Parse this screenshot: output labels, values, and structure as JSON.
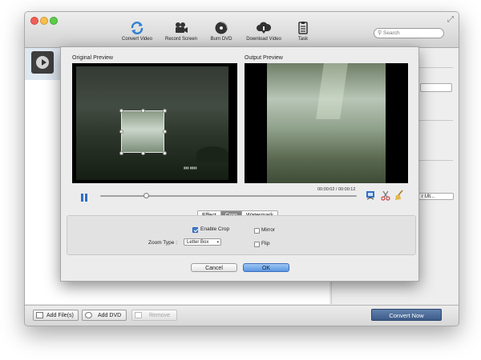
{
  "toolbar": {
    "items": [
      {
        "label": "Convert Video",
        "icon": "refresh-icon"
      },
      {
        "label": "Record Screen",
        "icon": "video-camera-icon"
      },
      {
        "label": "Burn DVD",
        "icon": "disc-icon"
      },
      {
        "label": "Download Video",
        "icon": "cloud-download-icon"
      },
      {
        "label": "Task",
        "icon": "clipboard-icon"
      }
    ],
    "search_placeholder": "Search"
  },
  "dialog": {
    "original_label": "Original Preview",
    "output_label": "Output Preview",
    "timecode": "00:00:02 / 00:00:12",
    "playback_progress": 0.18,
    "tabs": [
      "Effect",
      "Crop",
      "Watermark"
    ],
    "selected_tab": "Crop",
    "enable_crop_label": "Enable Crop",
    "enable_crop_checked": true,
    "mirror_label": "Mirror",
    "mirror_checked": false,
    "flip_label": "Flip",
    "flip_checked": false,
    "zoom_type_label": "Zoom Type :",
    "zoom_type_value": "Letter Box",
    "cancel_label": "Cancel",
    "ok_label": "OK"
  },
  "right_panel": {
    "select_value": "r Ult..."
  },
  "bottom": {
    "add_files_label": "Add File(s)",
    "add_dvd_label": "Add DVD",
    "remove_label": "Remove",
    "convert_now_label": "Convert Now"
  },
  "colors": {
    "accent_blue": "#3b7bd8",
    "convert_button": "#4a6893",
    "selected_tab": "#7a7a7a"
  }
}
